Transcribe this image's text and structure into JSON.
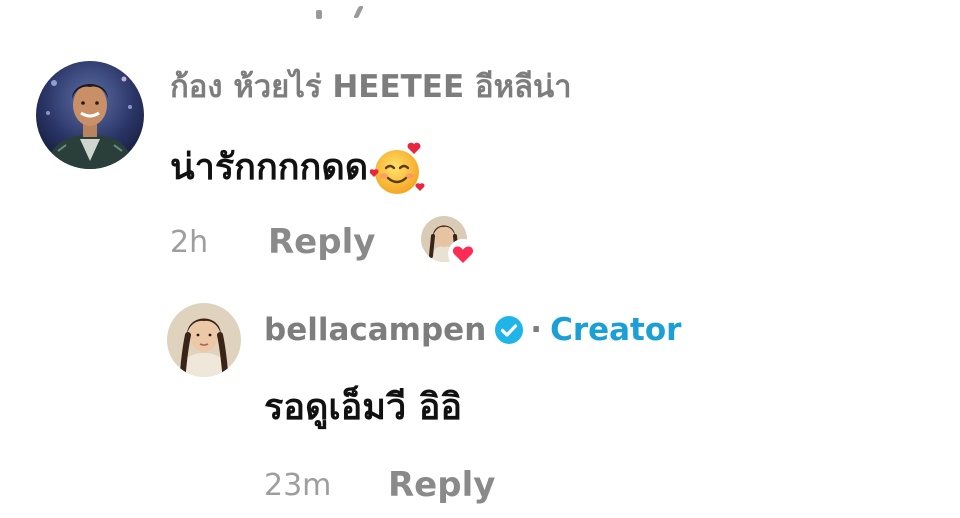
{
  "comment": {
    "author": "ก้อง ห้วยไร่ HEETEE อีหลีน่า",
    "text": "น่ารักกกกดด",
    "emoji_icon": "smiling-face-with-hearts-icon",
    "time": "2h",
    "reply_label": "Reply",
    "liked_by_creator": true
  },
  "reply": {
    "author": "bellacampen",
    "verified": true,
    "separator": "·",
    "badge": "Creator",
    "text": "รอดูเอ็มวี อิอิ",
    "time": "23m",
    "reply_label": "Reply"
  },
  "colors": {
    "author": "#7d7d7d",
    "body": "#111111",
    "meta": "#9e9e9e",
    "creator": "#1a9fd6",
    "verified": "#20b5e8",
    "heart": "#fe2c55"
  }
}
